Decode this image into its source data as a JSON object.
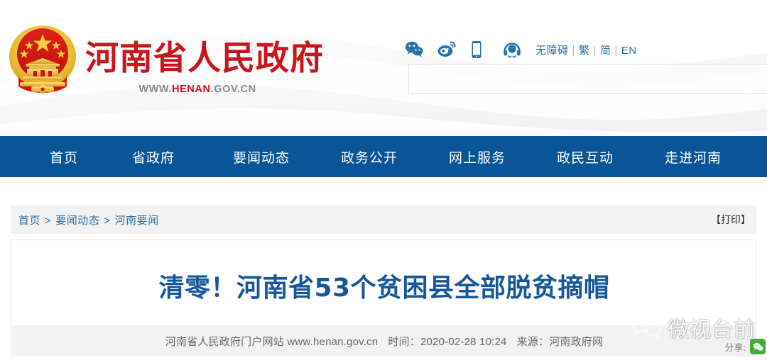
{
  "site": {
    "logo_title": "河南省人民政府",
    "logo_url_prefix": "WWW.",
    "logo_url_highlight": "HENAN",
    "logo_url_suffix": ".GOV.CN",
    "emblem_name": "national-emblem",
    "brand_red": "#c8161d",
    "nav_blue": "#0a5597",
    "link_blue": "#2b6ca3"
  },
  "header": {
    "social_icons": [
      {
        "name": "wechat-icon",
        "label": "微信"
      },
      {
        "name": "weibo-icon",
        "label": "微博"
      },
      {
        "name": "mobile-icon",
        "label": "手机版"
      },
      {
        "name": "service-headset-icon",
        "label": "客服"
      }
    ],
    "lang": {
      "accessibility": "无障碍",
      "traditional": "繁",
      "simplified": "简",
      "english": "EN",
      "separator": "|"
    },
    "search": {
      "value": "",
      "placeholder": ""
    }
  },
  "nav": {
    "items": [
      {
        "label": "首页"
      },
      {
        "label": "省政府"
      },
      {
        "label": "要闻动态"
      },
      {
        "label": "政务公开"
      },
      {
        "label": "网上服务"
      },
      {
        "label": "政民互动"
      },
      {
        "label": "走进河南"
      }
    ]
  },
  "breadcrumb": {
    "items": [
      "首页",
      "要闻动态",
      "河南要闻"
    ],
    "separator": ">",
    "print_label": "【打印】"
  },
  "article": {
    "title": "清零！河南省53个贫困县全部脱贫摘帽",
    "meta": {
      "site_name": "河南省人民政府门户网站",
      "site_url": "www.henan.gov.cn",
      "time_label": "时间：",
      "time_value": "2020-02-28 10:24",
      "source_label": "来源：",
      "source_value": "河南政府网"
    },
    "share": {
      "label": "分享:",
      "buttons": [
        {
          "name": "wechat-share-icon",
          "color": "#3eb135"
        }
      ]
    }
  },
  "watermark": {
    "text": "微视台前",
    "icon_name": "wechat-bubbles-icon"
  }
}
